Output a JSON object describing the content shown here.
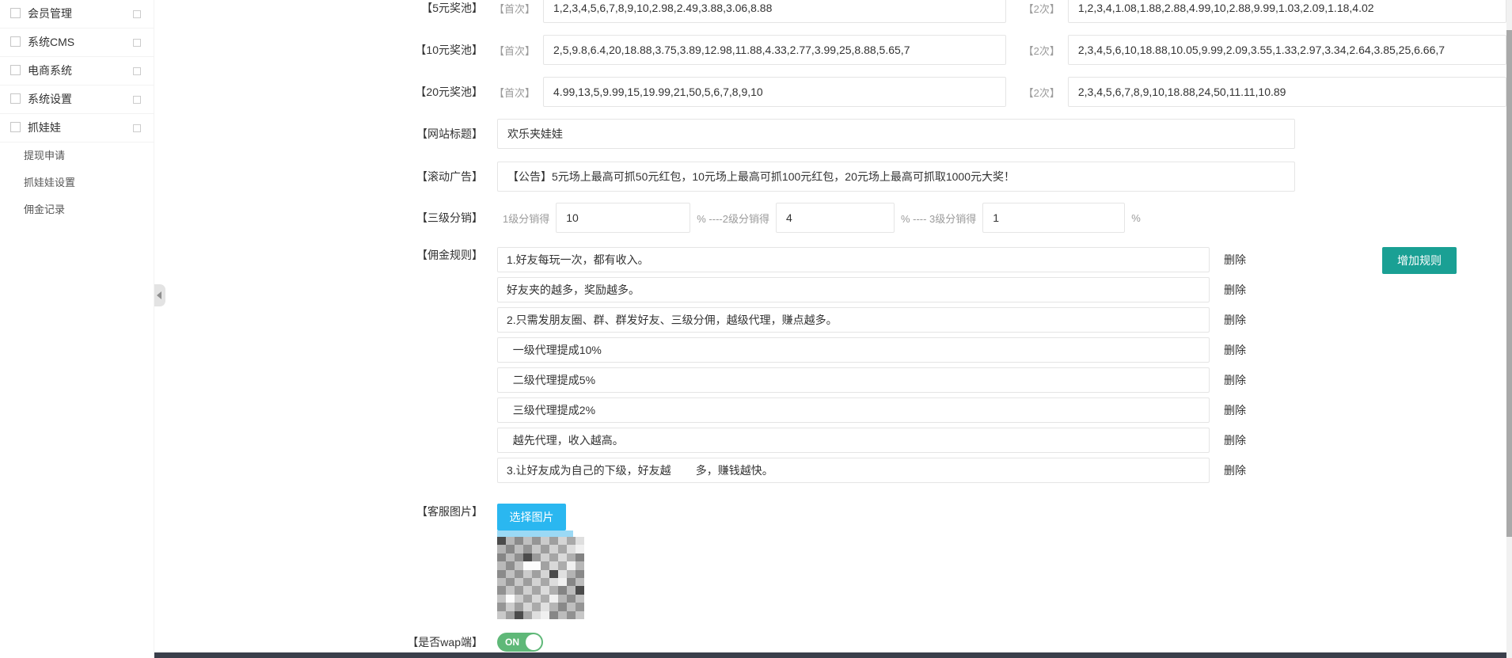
{
  "sidebar": {
    "items": [
      {
        "label": "会员管理"
      },
      {
        "label": "系统CMS"
      },
      {
        "label": "电商系统"
      },
      {
        "label": "系统设置"
      },
      {
        "label": "抓娃娃"
      }
    ],
    "sub_items": [
      {
        "label": "提现申请"
      },
      {
        "label": "抓娃娃设置"
      },
      {
        "label": "佣金记录"
      }
    ]
  },
  "form": {
    "tags": {
      "first": "【首次】",
      "second": "【2次】"
    },
    "pools": [
      {
        "label": "【5元奖池】",
        "first_value": "1,2,3,4,5,6,7,8,9,10,2.98,2.49,3.88,3.06,8.88",
        "second_value": "1,2,3,4,1.08,1.88,2.88,4.99,10,2.88,9.99,1.03,2.09,1.18,4.02"
      },
      {
        "label": "【10元奖池】",
        "first_value": "2,5,9.8,6.4,20,18.88,3.75,3.89,12.98,11.88,4.33,2.77,3.99,25,8.88,5.65,7",
        "second_value": "2,3,4,5,6,10,18.88,10.05,9.99,2.09,3.55,1.33,2.97,3.34,2.64,3.85,25,6.66,7"
      },
      {
        "label": "【20元奖池】",
        "first_value": "4.99,13,5,9.99,15,19.99,21,50,5,6,7,8,9,10",
        "second_value": "2,3,4,5,6,7,8,9,10,18.88,24,50,11.11,10.89"
      }
    ],
    "site_title": {
      "label": "【网站标题】",
      "value": "欢乐夹娃娃"
    },
    "marquee": {
      "label": "【滚动广告】",
      "value": "【公告】5元场上最高可抓50元红包，10元场上最高可抓100元红包，20元场上最高可抓取1000元大奖！"
    },
    "distribution": {
      "label": "【三级分销】",
      "level1_prefix": "1级分销得",
      "level1_value": "10",
      "level2_prefix": "% ----2级分销得",
      "level2_value": "4",
      "level3_prefix": "% ---- 3级分销得",
      "level3_value": "1",
      "suffix": "%"
    },
    "rules": {
      "label": "【佣金规则】",
      "items": [
        "1.好友每玩一次，都有收入。",
        "好友夹的越多，奖励越多。",
        "2.只需发朋友圈、群、群发好友、三级分佣，越级代理，赚点越多。",
        "  一级代理提成10%",
        "  二级代理提成5%",
        "  三级代理提成2%",
        "  越先代理，收入越高。",
        "3.让好友成为自己的下级，好友越        多，赚钱越快。"
      ],
      "delete_label": "删除",
      "add_button": "增加规则"
    },
    "customer_image": {
      "label": "【客服图片】",
      "button": "选择图片"
    },
    "wap": {
      "label": "【是否wap端】",
      "state": "ON"
    }
  },
  "colors": {
    "add_button_bg": "#1aa094",
    "pick_button_bg": "#2ab7f0",
    "toggle_on": "#5FB878",
    "bottom_bar": "#3a3f4b"
  }
}
